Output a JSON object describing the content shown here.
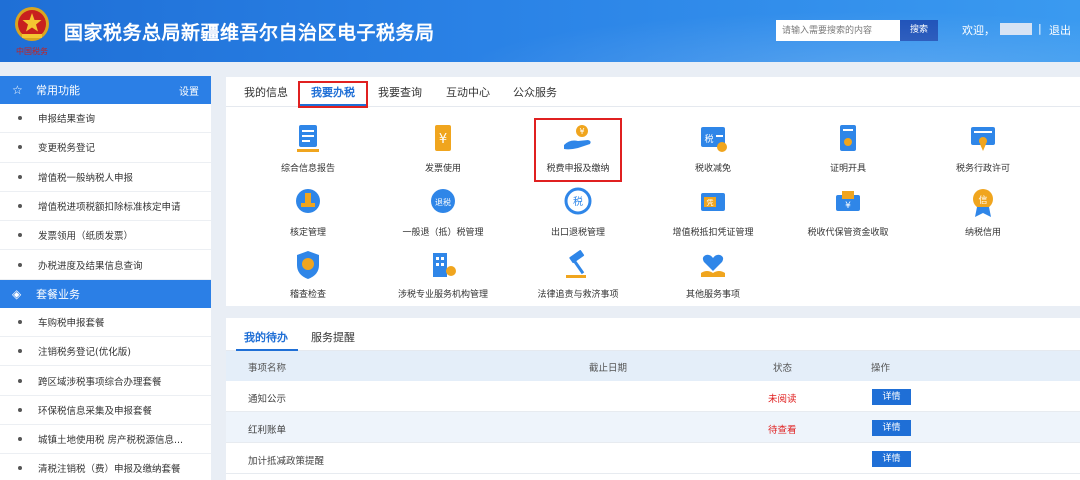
{
  "header": {
    "title": "国家税务总局新疆维吾尔自治区电子税务局",
    "emblem_text": "中国税务",
    "search_placeholder": "请输入需要搜索的内容",
    "search_button": "搜索",
    "welcome": "欢迎，",
    "separator": "|",
    "logout": "退出"
  },
  "sidebar": {
    "common": {
      "title": "常用功能",
      "settings": "设置",
      "items": [
        {
          "label": "申报结果查询"
        },
        {
          "label": "变更税务登记"
        },
        {
          "label": "增值税一般纳税人申报"
        },
        {
          "label": "增值税进项税额扣除标准核定申请"
        },
        {
          "label": "发票领用（纸质发票）"
        },
        {
          "label": "办税进度及结果信息查询"
        }
      ]
    },
    "package": {
      "title": "套餐业务",
      "items": [
        {
          "label": "车购税申报套餐"
        },
        {
          "label": "注销税务登记(优化版)"
        },
        {
          "label": "跨区域涉税事项综合办理套餐"
        },
        {
          "label": "环保税信息采集及申报套餐"
        },
        {
          "label": "城镇土地使用税 房产税税源信息..."
        },
        {
          "label": "清税注销税（费）申报及缴纳套餐"
        }
      ]
    }
  },
  "main": {
    "tabs": [
      {
        "label": "我的信息"
      },
      {
        "label": "我要办税"
      },
      {
        "label": "我要查询"
      },
      {
        "label": "互动中心"
      },
      {
        "label": "公众服务"
      }
    ],
    "services": [
      {
        "label": "综合信息报告",
        "icon": "document-report-icon"
      },
      {
        "label": "发票使用",
        "icon": "invoice-icon"
      },
      {
        "label": "税费申报及缴纳",
        "icon": "hand-coin-icon"
      },
      {
        "label": "税收减免",
        "icon": "tax-relief-icon"
      },
      {
        "label": "证明开具",
        "icon": "certificate-icon"
      },
      {
        "label": "税务行政许可",
        "icon": "license-icon"
      },
      {
        "label": "核定管理",
        "icon": "stamp-icon"
      },
      {
        "label": "一般退（抵）税管理",
        "icon": "tax-refund-icon"
      },
      {
        "label": "出口退税管理",
        "icon": "export-refund-icon"
      },
      {
        "label": "增值税抵扣凭证管理",
        "icon": "voucher-icon"
      },
      {
        "label": "税收代保管资金收取",
        "icon": "money-custody-icon"
      },
      {
        "label": "纳税信用",
        "icon": "credit-medal-icon"
      },
      {
        "label": "稽查检查",
        "icon": "inspection-shield-icon"
      },
      {
        "label": "涉税专业服务机构管理",
        "icon": "building-gear-icon"
      },
      {
        "label": "法律追责与救济事项",
        "icon": "gavel-icon"
      },
      {
        "label": "其他服务事项",
        "icon": "heart-hand-icon"
      }
    ]
  },
  "todo": {
    "tabs": [
      {
        "label": "我的待办"
      },
      {
        "label": "服务提醒"
      }
    ],
    "columns": {
      "name": "事项名称",
      "deadline": "截止日期",
      "status": "状态",
      "action": "操作"
    },
    "rows": [
      {
        "name": "通知公示",
        "deadline": "",
        "status": "未阅读",
        "action": "详情"
      },
      {
        "name": "红利账单",
        "deadline": "",
        "status": "待查看",
        "action": "详情"
      },
      {
        "name": "加计抵减政策提醒",
        "deadline": "",
        "status": "",
        "action": "详情"
      }
    ]
  },
  "colors": {
    "header_blue": "#2a82e6",
    "accent": "#1f6fd6",
    "highlight_red": "#e02020",
    "status_red": "#e02020"
  }
}
